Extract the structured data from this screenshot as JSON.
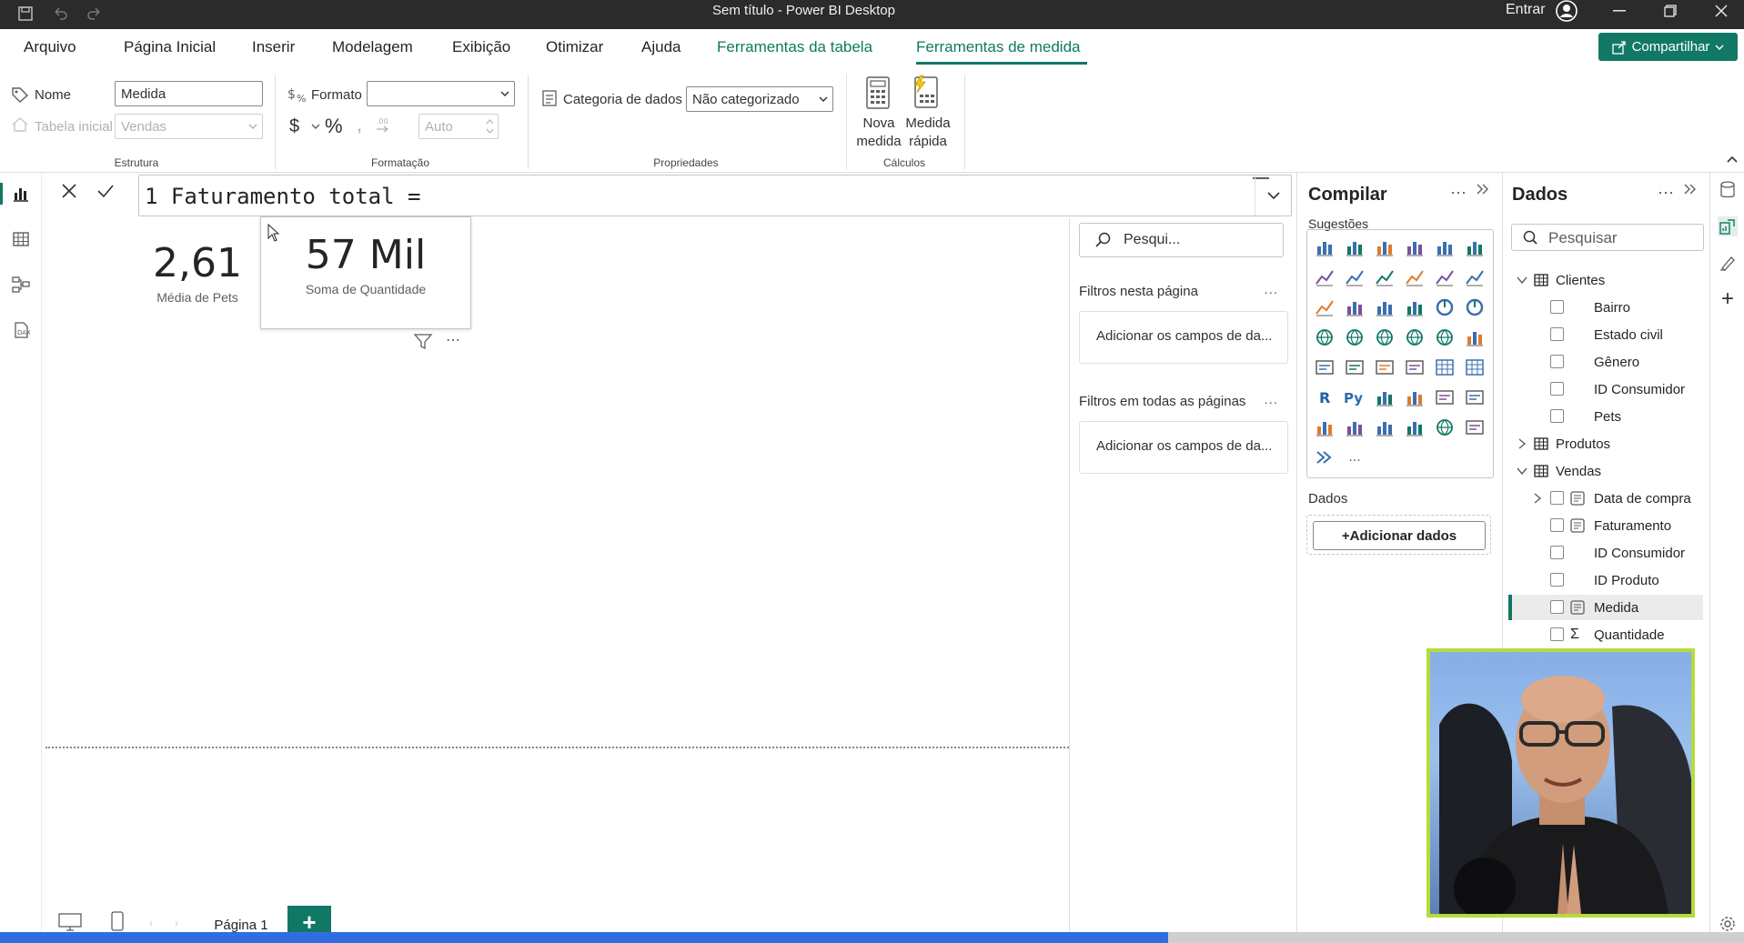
{
  "window": {
    "title": "Sem título - Power BI Desktop",
    "signin_label": "Entrar"
  },
  "menu": {
    "items": [
      "Arquivo",
      "Página Inicial",
      "Inserir",
      "Modelagem",
      "Exibição",
      "Otimizar",
      "Ajuda"
    ],
    "context_tabs": [
      "Ferramentas da tabela",
      "Ferramentas de medida"
    ],
    "active_tab": "Ferramentas de medida",
    "share_label": "Compartilhar"
  },
  "ribbon": {
    "estrutura": {
      "name_label": "Nome",
      "name_value": "Medida",
      "home_table_label": "Tabela inicial",
      "home_table_value": "Vendas",
      "group": "Estrutura"
    },
    "formatacao": {
      "format_label": "Formato",
      "format_value": "",
      "currency": "$",
      "percent": "%",
      "comma": ",",
      "decimals_value": "Auto",
      "group": "Formatação"
    },
    "propriedades": {
      "category_label": "Categoria de dados",
      "category_value": "Não categorizado",
      "group": "Propriedades"
    },
    "calculos": {
      "new_measure_line1": "Nova",
      "new_measure_line2": "medida",
      "quick_measure_line1": "Medida",
      "quick_measure_line2": "rápida",
      "group": "Cálculos"
    }
  },
  "formula": {
    "text": "1 Faturamento total ="
  },
  "canvas": {
    "cards": [
      {
        "value": "2,61",
        "label": "Média de Pets"
      },
      {
        "value": "57 Mil",
        "label": "Soma de Quantidade"
      }
    ]
  },
  "pages": {
    "tab_label": "Página 1",
    "add_label": "+"
  },
  "filters": {
    "search_placeholder": "Pesqui...",
    "this_page": "Filtros nesta página",
    "all_pages": "Filtros em todas as páginas",
    "drop_hint": "Adicionar os campos de da...",
    "more": "..."
  },
  "build": {
    "title": "Compilar",
    "suggestions": "Sugestões",
    "data_label": "Dados",
    "add_data": "+Adicionar dados",
    "more_viz": "..."
  },
  "data_pane": {
    "title": "Dados",
    "search_placeholder": "Pesquisar",
    "tables": [
      {
        "name": "Clientes",
        "expanded": true,
        "fields": [
          "Bairro",
          "Estado civil",
          "Gênero",
          "ID Consumidor",
          "Pets"
        ]
      },
      {
        "name": "Produtos",
        "expanded": false,
        "fields": []
      },
      {
        "name": "Vendas",
        "expanded": true,
        "fields": [
          "Data de compra",
          "Faturamento",
          "ID Consumidor",
          "ID Produto",
          "Medida",
          "Quantidade"
        ]
      }
    ],
    "selected_field": "Medida"
  },
  "progress": {
    "fraction": 0.67
  },
  "colors": {
    "accent": "#117865",
    "titlebar": "#2b2b2b",
    "webcam_border": "#b5db3c"
  }
}
